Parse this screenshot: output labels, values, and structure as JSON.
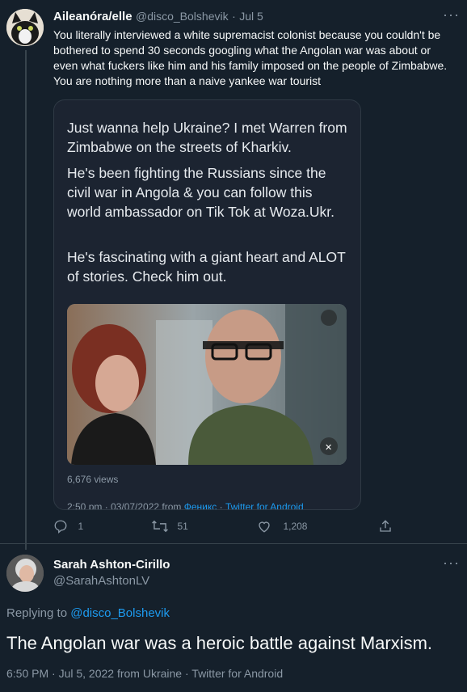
{
  "tweet1": {
    "display_name": "Aileanóra/elle",
    "handle": "@disco_Bolshevik",
    "separator": "·",
    "date": "Jul 5",
    "more": "···",
    "text": "You literally interviewed a white supremacist colonist because you couldn't be bothered to spend 30 seconds googling what the Angolan war was about or even what fuckers like him and his family imposed on the people of Zimbabwe. You are nothing more than a naive yankee war tourist",
    "embedded": {
      "paragraphs": [
        "Just wanna help Ukraine? I met Warren from Zimbabwe on the streets of Kharkiv.",
        "He's been fighting the Russians since the civil war in Angola & you can follow this world ambassador on Tik Tok at Woza.Ukr.",
        "He's fascinating with a giant heart and ALOT of stories. Check him out."
      ],
      "views": "6,676 views",
      "footer_prefix": "2:50 pm · 03/07/2022 from ",
      "footer_location": "Феникс",
      "footer_sep": " · ",
      "footer_client": "Twitter for Android"
    },
    "actions": {
      "replies": "1",
      "retweets": "51",
      "likes": "1,208"
    }
  },
  "tweet2": {
    "display_name": "Sarah Ashton-Cirillo",
    "handle": "@SarahAshtonLV",
    "more": "···",
    "replying_prefix": "Replying to ",
    "replying_handle": "@disco_Bolshevik",
    "text": "The Angolan war was a heroic battle against Marxism.",
    "meta": "6:50 PM · Jul 5, 2022 from Ukraine · Twitter for Android"
  },
  "colors": {
    "background": "#15202b",
    "text": "#f7f9f9",
    "muted": "#8b98a5",
    "link": "#1d9bf0",
    "border": "#38444d"
  }
}
